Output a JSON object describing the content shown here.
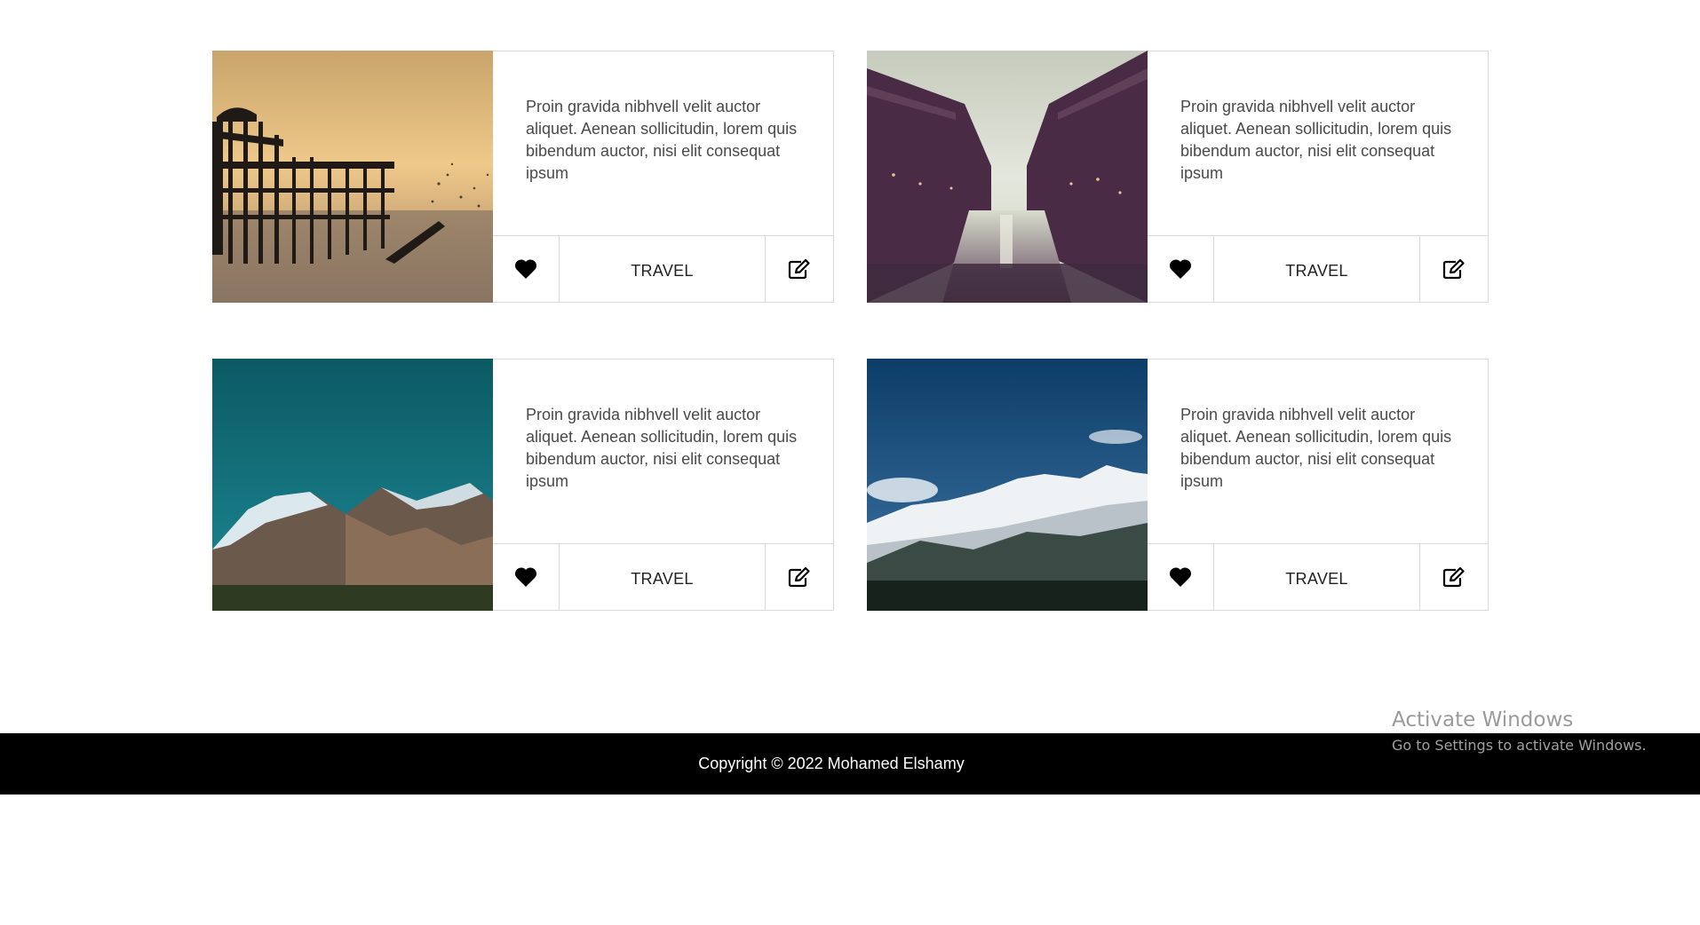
{
  "cards": [
    {
      "image": "pier-sunset-photo",
      "text": "Proin gravida nibhvell velit auctor aliquet. Aenean sollicitudin, lorem quis bibendum auctor, nisi elit consequat ipsum",
      "tag": "TRAVEL",
      "icons": {
        "like": "heart-icon",
        "edit": "edit-icon"
      }
    },
    {
      "image": "canal-city-photo",
      "text": "Proin gravida nibhvell velit auctor aliquet. Aenean sollicitudin, lorem quis bibendum auctor, nisi elit consequat ipsum",
      "tag": "TRAVEL",
      "icons": {
        "like": "heart-icon",
        "edit": "edit-icon"
      }
    },
    {
      "image": "teal-mountain-photo",
      "text": "Proin gravida nibhvell velit auctor aliquet. Aenean sollicitudin, lorem quis bibendum auctor, nisi elit consequat ipsum",
      "tag": "TRAVEL",
      "icons": {
        "like": "heart-icon",
        "edit": "edit-icon"
      }
    },
    {
      "image": "snow-mountain-photo",
      "text": "Proin gravida nibhvell velit auctor aliquet. Aenean sollicitudin, lorem quis bibendum auctor, nisi elit consequat ipsum",
      "tag": "TRAVEL",
      "icons": {
        "like": "heart-icon",
        "edit": "edit-icon"
      }
    }
  ],
  "footer": {
    "copyright": "Copyright © 2022 Mohamed Elshamy"
  },
  "watermark": {
    "title": "Activate Windows",
    "subtitle": "Go to Settings to activate Windows."
  },
  "colors": {
    "footer_bg": "#000000",
    "border": "#d9d9d9",
    "text": "#4a4a4a"
  }
}
